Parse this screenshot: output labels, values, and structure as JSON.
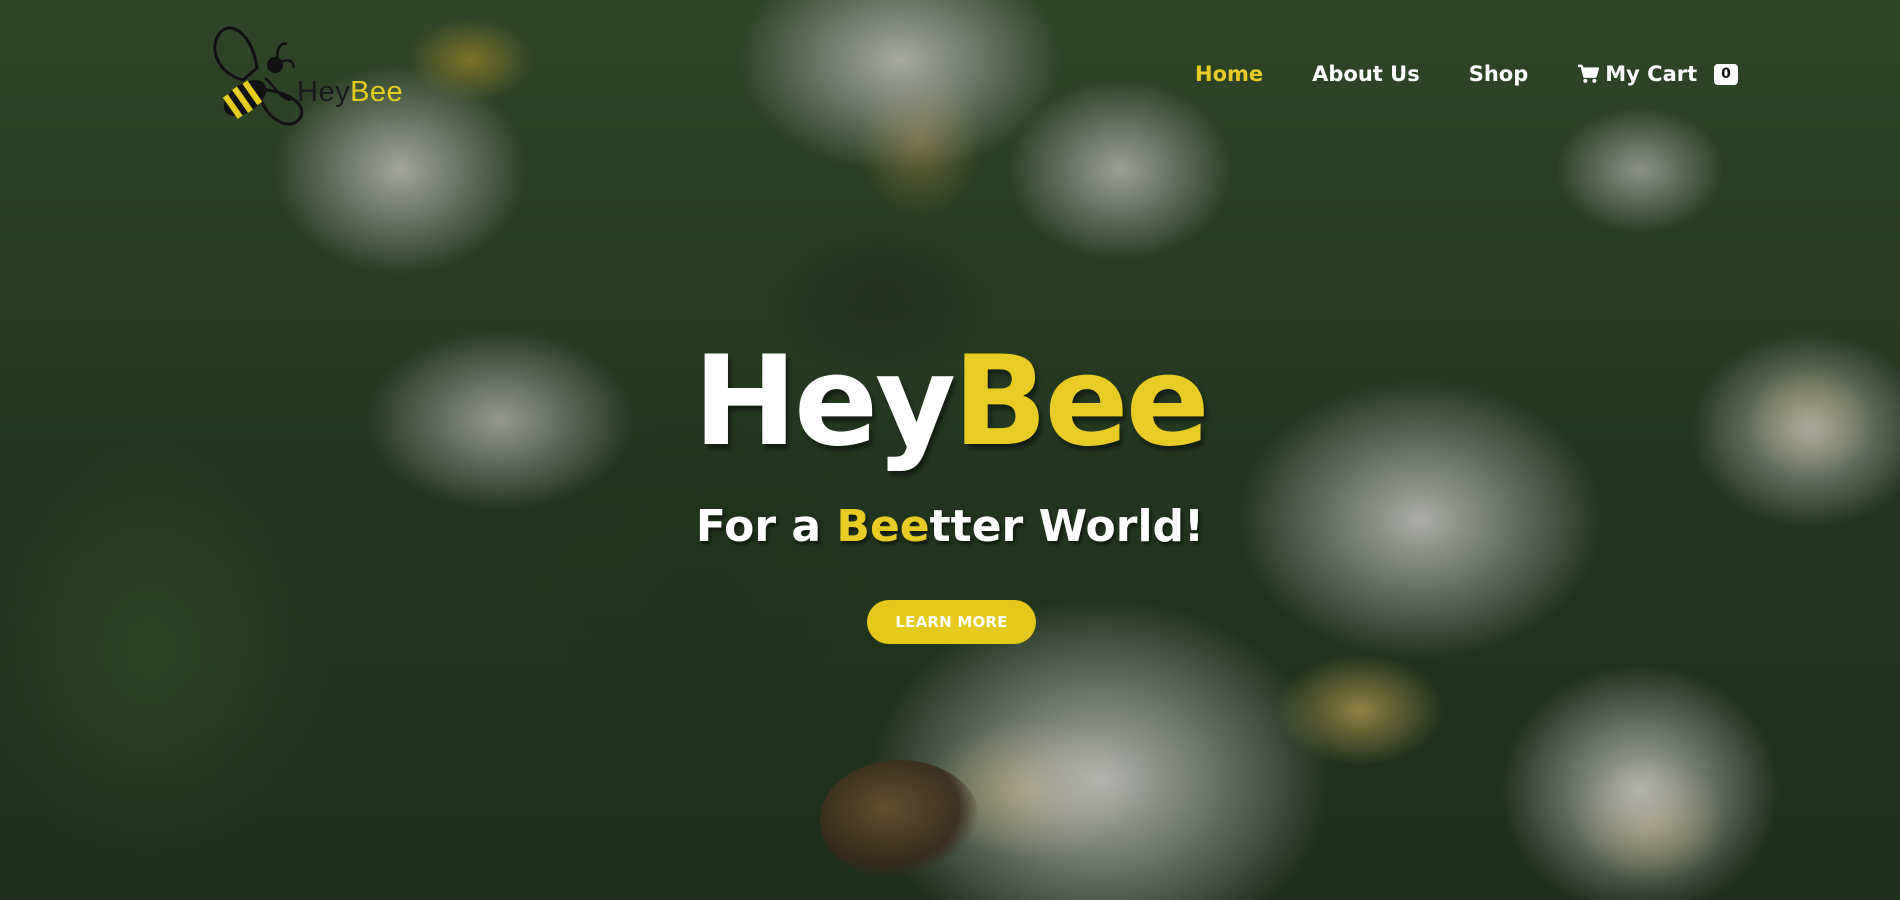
{
  "brand": {
    "logo_prefix": "Hey",
    "logo_suffix": "Bee"
  },
  "nav": {
    "items": [
      {
        "label": "Home",
        "active": true
      },
      {
        "label": "About Us",
        "active": false
      },
      {
        "label": "Shop",
        "active": false
      }
    ],
    "cart_label": "My Cart",
    "cart_count": "0"
  },
  "hero": {
    "title_prefix": "Hey",
    "title_suffix": "Bee",
    "subtitle_before": "For a ",
    "subtitle_highlight": "Bee",
    "subtitle_after": "tter World!",
    "button_label": "LEARN MORE"
  },
  "colors": {
    "accent": "#e8cc25",
    "text": "#ffffff"
  }
}
